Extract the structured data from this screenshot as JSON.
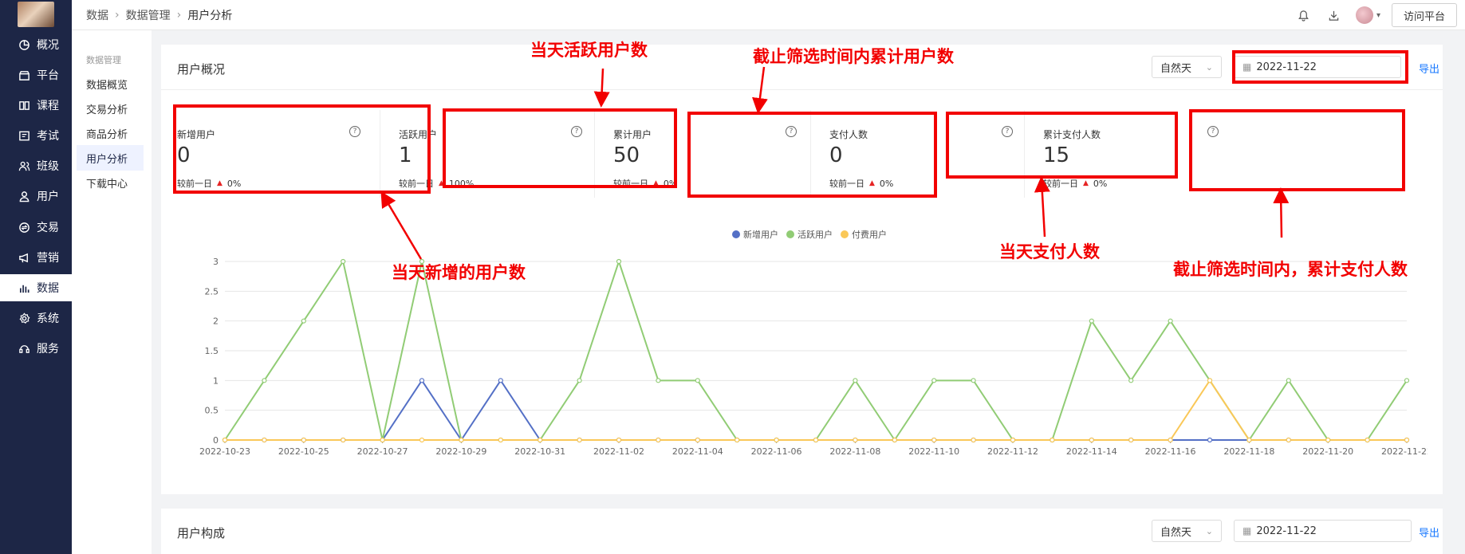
{
  "breadcrumb": [
    "数据",
    "数据管理",
    "用户分析"
  ],
  "topbar": {
    "icons": [
      "bell-icon",
      "download-icon",
      "avatar",
      "chevron-down-icon"
    ],
    "visit_label": "访问平台"
  },
  "nav": {
    "items": [
      {
        "label": "概况",
        "icon": "pie-icon"
      },
      {
        "label": "平台",
        "icon": "store-icon"
      },
      {
        "label": "课程",
        "icon": "book-icon"
      },
      {
        "label": "考试",
        "icon": "exam-icon"
      },
      {
        "label": "班级",
        "icon": "group-icon"
      },
      {
        "label": "用户",
        "icon": "user-icon"
      },
      {
        "label": "交易",
        "icon": "exchange-icon"
      },
      {
        "label": "营销",
        "icon": "megaphone-icon"
      },
      {
        "label": "数据",
        "icon": "bar-chart-icon",
        "active": true
      },
      {
        "label": "系统",
        "icon": "gear-icon"
      },
      {
        "label": "服务",
        "icon": "service-icon"
      }
    ]
  },
  "submenu": {
    "group": "数据管理",
    "items": [
      "数据概览",
      "交易分析",
      "商品分析",
      "用户分析",
      "下载中心"
    ],
    "active": "用户分析"
  },
  "overview": {
    "title": "用户概况",
    "range_select": "自然天",
    "date": "2022-11-22",
    "export": "导出",
    "cards": [
      {
        "label": "新增用户",
        "value": "0",
        "compare_label": "较前一日",
        "compare": "0%"
      },
      {
        "label": "活跃用户",
        "value": "1",
        "compare_label": "较前一日",
        "compare": "100%"
      },
      {
        "label": "累计用户",
        "value": "50",
        "compare_label": "较前一日",
        "compare": "0%"
      },
      {
        "label": "支付人数",
        "value": "0",
        "compare_label": "较前一日",
        "compare": "0%"
      },
      {
        "label": "累计支付人数",
        "value": "15",
        "compare_label": "较前一日",
        "compare": "0%"
      }
    ]
  },
  "composition": {
    "title": "用户构成",
    "range_select": "自然天",
    "date": "2022-11-22",
    "export": "导出"
  },
  "annotations": {
    "active_today": "当天活跃用户数",
    "cumulative_users": "截止筛选时间内累计用户数",
    "new_today": "当天新增的用户数",
    "paid_today": "当天支付人数",
    "cumulative_paid": "截止筛选时间内，累计支付人数",
    "color": "#f20000"
  },
  "chart_data": {
    "type": "line",
    "x": [
      "2022-10-23",
      "2022-10-24",
      "2022-10-25",
      "2022-10-26",
      "2022-10-27",
      "2022-10-28",
      "2022-10-29",
      "2022-10-30",
      "2022-10-31",
      "2022-11-01",
      "2022-11-02",
      "2022-11-03",
      "2022-11-04",
      "2022-11-05",
      "2022-11-06",
      "2022-11-07",
      "2022-11-08",
      "2022-11-09",
      "2022-11-10",
      "2022-11-11",
      "2022-11-12",
      "2022-11-13",
      "2022-11-14",
      "2022-11-15",
      "2022-11-16",
      "2022-11-17",
      "2022-11-18",
      "2022-11-19",
      "2022-11-20",
      "2022-11-21",
      "2022-11-22"
    ],
    "x_tick_labels": [
      "2022-10-23",
      "2022-10-25",
      "2022-10-27",
      "2022-10-29",
      "2022-10-31",
      "2022-11-02",
      "2022-11-04",
      "2022-11-06",
      "2022-11-08",
      "2022-11-10",
      "2022-11-12",
      "2022-11-14",
      "2022-11-16",
      "2022-11-18",
      "2022-11-20",
      "2022-11-22"
    ],
    "y_ticks": [
      "0",
      "0.5",
      "1",
      "1.5",
      "2",
      "2.5",
      "3"
    ],
    "ylim": [
      0,
      3
    ],
    "grid": true,
    "legend_position": "top-center",
    "series": [
      {
        "name": "新增用户",
        "color": "#5470c6",
        "values": [
          0,
          0,
          0,
          0,
          0,
          1,
          0,
          1,
          0,
          0,
          0,
          0,
          0,
          0,
          0,
          0,
          0,
          0,
          0,
          0,
          0,
          0,
          0,
          0,
          0,
          0,
          0,
          0,
          0,
          0,
          0
        ]
      },
      {
        "name": "活跃用户",
        "color": "#91cc75",
        "values": [
          0,
          1,
          2,
          3,
          0,
          3,
          0,
          0,
          0,
          1,
          3,
          1,
          1,
          0,
          0,
          0,
          1,
          0,
          1,
          1,
          0,
          0,
          2,
          1,
          2,
          1,
          0,
          1,
          0,
          0,
          1
        ]
      },
      {
        "name": "付费用户",
        "color": "#fac858",
        "values": [
          0,
          0,
          0,
          0,
          0,
          0,
          0,
          0,
          0,
          0,
          0,
          0,
          0,
          0,
          0,
          0,
          0,
          0,
          0,
          0,
          0,
          0,
          0,
          0,
          0,
          1,
          0,
          0,
          0,
          0,
          0
        ]
      }
    ]
  }
}
